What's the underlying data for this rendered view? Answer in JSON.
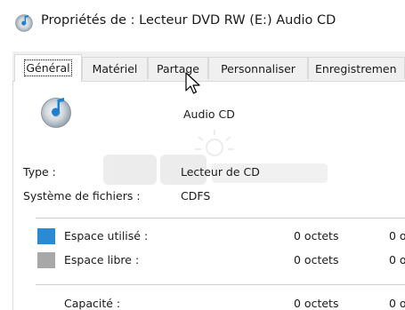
{
  "window": {
    "title": "Propriétés de : Lecteur DVD RW (E:) Audio CD"
  },
  "tabs": [
    {
      "label": "Général",
      "active": true
    },
    {
      "label": "Matériel",
      "active": false
    },
    {
      "label": "Partage",
      "active": false
    },
    {
      "label": "Personnaliser",
      "active": false
    },
    {
      "label": "Enregistremen",
      "active": false
    }
  ],
  "general": {
    "volume_label": "Audio CD",
    "type_label": "Type :",
    "type_value": "Lecteur de CD",
    "fs_label": "Système de fichiers :",
    "fs_value": "CDFS"
  },
  "space": {
    "used_label": "Espace utilisé :",
    "used_bytes": "0 octets",
    "used_size": "0 o",
    "free_label": "Espace libre :",
    "free_bytes": "0 octets",
    "free_size": "0 o",
    "capacity_label": "Capacité :",
    "capacity_bytes": "0 octets",
    "capacity_size": "0 o"
  },
  "colors": {
    "used_swatch": "#2a8ad4",
    "free_swatch": "#a8a8a8",
    "accent": "#0078d7"
  },
  "icons": {
    "title": "cd-audio-icon",
    "volume": "cd-audio-icon",
    "cursor": "mouse-pointer-icon"
  }
}
